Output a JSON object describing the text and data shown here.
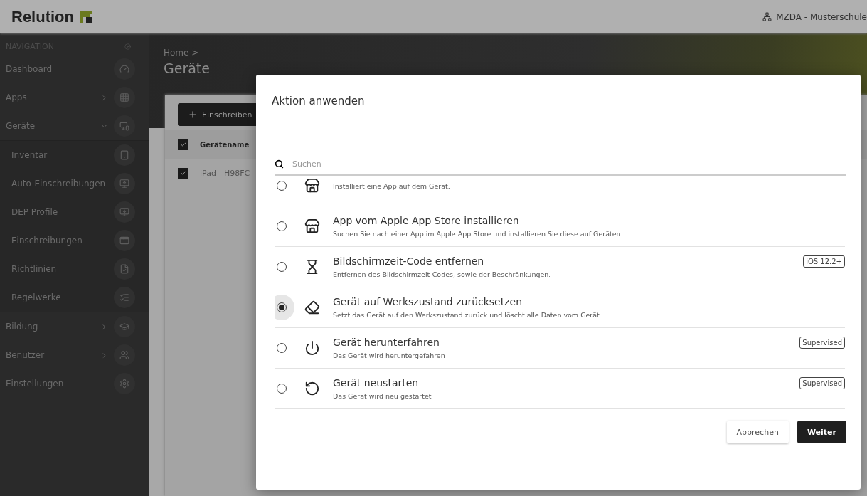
{
  "topbar": {
    "logo": "Relution",
    "org": "MZDA - Musterschule"
  },
  "sidebar": {
    "header": "NAVIGATION",
    "items": [
      {
        "label": "Dashboard"
      },
      {
        "label": "Apps",
        "expanded": false
      },
      {
        "label": "Geräte",
        "expanded": true,
        "children": [
          {
            "label": "Inventar"
          },
          {
            "label": "Auto-Einschreibungen"
          },
          {
            "label": "DEP Profile"
          },
          {
            "label": "Einschreibungen"
          },
          {
            "label": "Richtlinien"
          },
          {
            "label": "Regelwerke"
          }
        ]
      },
      {
        "label": "Bildung",
        "expanded": false
      },
      {
        "label": "Benutzer",
        "expanded": false
      },
      {
        "label": "Einstellungen"
      }
    ]
  },
  "page": {
    "breadcrumb": "Home >",
    "title": "Geräte",
    "enroll_button": "Einschreiben",
    "table": {
      "columns": [
        {
          "label": "Gerätename",
          "checked": true
        }
      ],
      "rows": [
        {
          "name": "iPad - H98FC",
          "checked": true
        }
      ]
    }
  },
  "dialog": {
    "title": "Aktion anwenden",
    "search": {
      "placeholder": "Suchen"
    },
    "actions": [
      {
        "description": "Installiert eine App auf dem Gerät.",
        "selected": false
      },
      {
        "title": "App vom Apple App Store installieren",
        "description": "Suchen Sie nach einer App im Apple App Store und installieren Sie diese auf Geräten",
        "selected": false
      },
      {
        "title": "Bildschirmzeit-Code entfernen",
        "description": "Entfernen des Bildschirmzeit-Codes, sowie der Beschränkungen.",
        "selected": false,
        "badges": [
          "iOS 12.2+"
        ]
      },
      {
        "title": "Gerät auf Werkszustand zurücksetzen",
        "description": "Setzt das Gerät auf den Werkszustand zurück und löscht alle Daten vom Gerät.",
        "selected": true
      },
      {
        "title": "Gerät herunterfahren",
        "description": "Das Gerät wird heruntergefahren",
        "selected": false,
        "badges": [
          "Supervised"
        ]
      },
      {
        "title": "Gerät neustarten",
        "description": "Das Gerät wird neu gestartet",
        "selected": false,
        "badges": [
          "Supervised"
        ]
      }
    ],
    "buttons": [
      {
        "label": "Abbrechen",
        "kind": "secondary"
      },
      {
        "label": "Weiter",
        "kind": "primary"
      }
    ]
  }
}
